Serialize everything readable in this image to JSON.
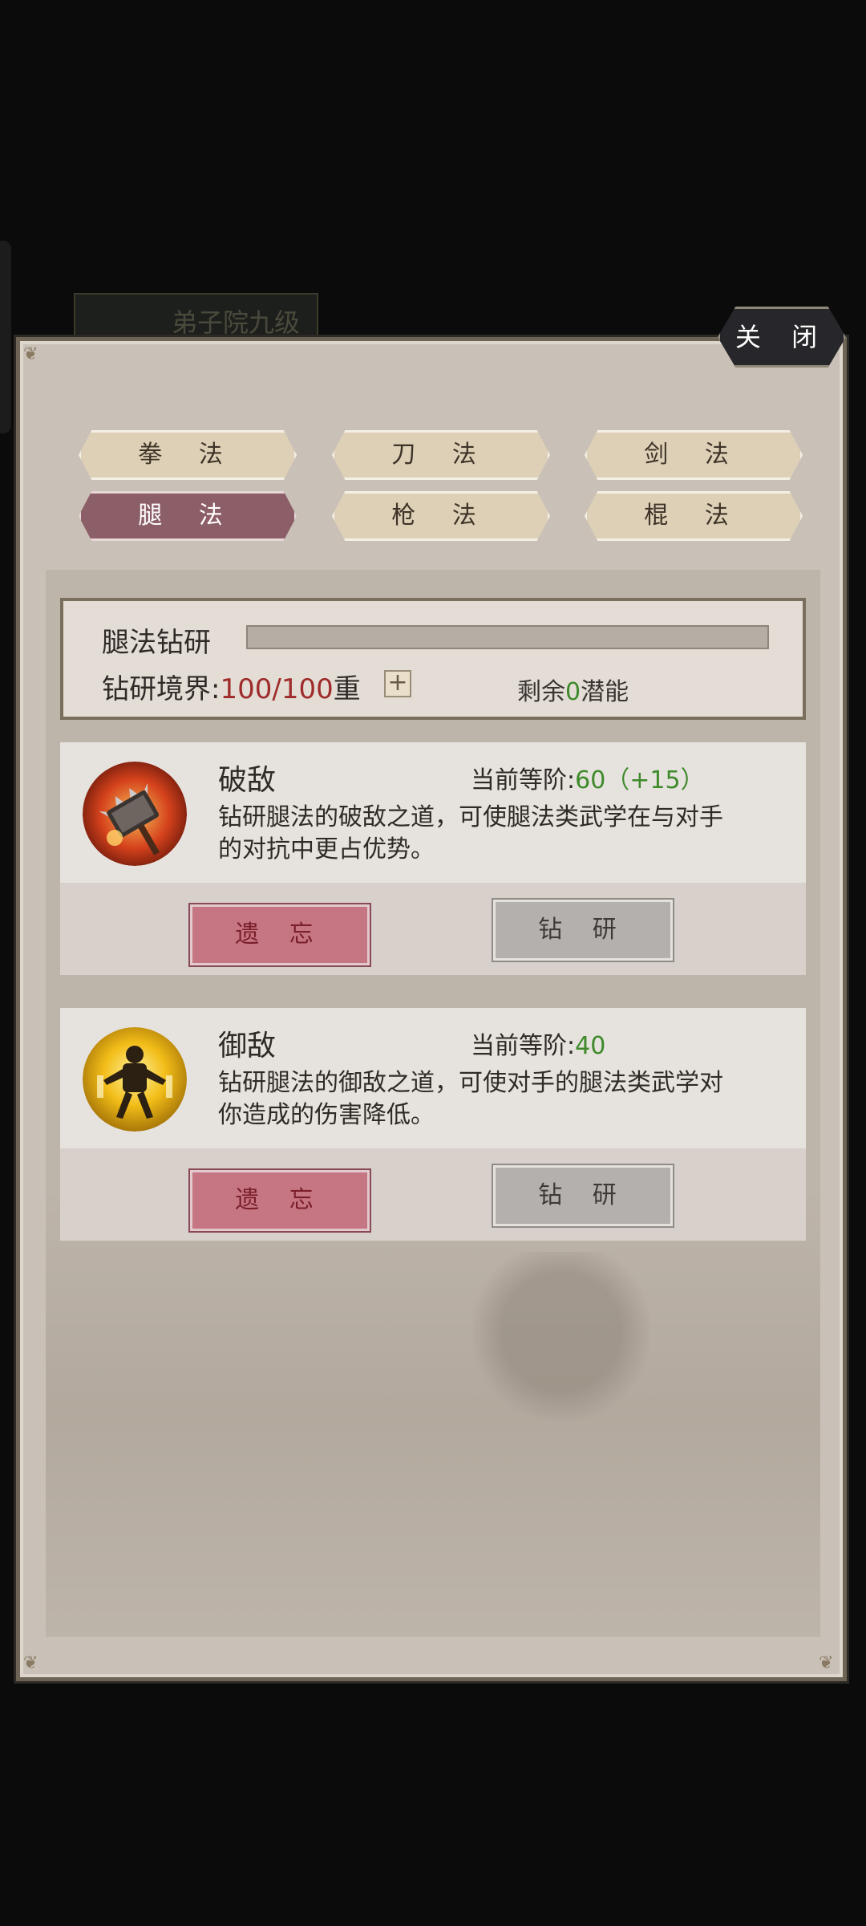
{
  "background": {
    "rank_label": "弟子院九级"
  },
  "close_label": "关 闭",
  "tabs": [
    {
      "label": "拳 法",
      "active": false
    },
    {
      "label": "刀 法",
      "active": false
    },
    {
      "label": "剑 法",
      "active": false
    },
    {
      "label": "腿 法",
      "active": true
    },
    {
      "label": "枪 法",
      "active": false
    },
    {
      "label": "棍 法",
      "active": false
    }
  ],
  "research": {
    "title": "腿法钻研",
    "realm_label": "钻研境界:",
    "realm_value": "100/100",
    "realm_unit": "重",
    "plus_label": "+",
    "remain_prefix": "剩余",
    "remain_value": "0",
    "remain_suffix": "潜能",
    "progress": 1.0
  },
  "skills": [
    {
      "name": "破敌",
      "icon": "broken-weapon-icon",
      "tier_label": "当前等阶:",
      "tier_value": "60（+15）",
      "description": "钻研腿法的破敌之道，可使腿法类武学在与对手的对抗中更占优势。",
      "forget_label": "遗 忘",
      "study_label": "钻 研"
    },
    {
      "name": "御敌",
      "icon": "defending-fighter-icon",
      "tier_label": "当前等阶:",
      "tier_value": "40",
      "description": "钻研腿法的御敌之道，可使对手的腿法类武学对你造成的伤害降低。",
      "forget_label": "遗 忘",
      "study_label": "钻 研"
    }
  ],
  "colors": {
    "panel_bg": "#c9c1b8",
    "active_tab": "#8c5e67",
    "forget_button": "#c67683",
    "study_button": "#b3b0ad",
    "highlight_green": "#3e8a2a",
    "highlight_red": "#9f2c2a"
  }
}
